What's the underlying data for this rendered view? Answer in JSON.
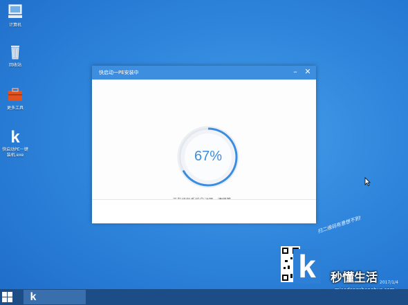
{
  "desktop": {
    "icons": [
      {
        "label": "计算机",
        "icon": "computer-icon"
      },
      {
        "label": "回收站",
        "icon": "recycle-bin-icon"
      },
      {
        "label": "更多工具",
        "icon": "toolbox-icon"
      },
      {
        "label": "快启动PE一键装机.exe",
        "icon": "kuaiqidong-app-icon"
      }
    ]
  },
  "dialog": {
    "title": "快启动一PE安装中",
    "progress_percent": 67,
    "progress_text": "67%",
    "status": "正在修复系统启动项，请稍等..."
  },
  "promo": {
    "tagline": "扫二维码有意想不到!",
    "date": "2017/1/4",
    "watermark_main": "秒懂生活",
    "watermark_sub": "miaodongshenghuo.com"
  },
  "colors": {
    "accent": "#3e8ee0",
    "desktop": "#2f86dc",
    "taskbar": "#1c4d86"
  }
}
